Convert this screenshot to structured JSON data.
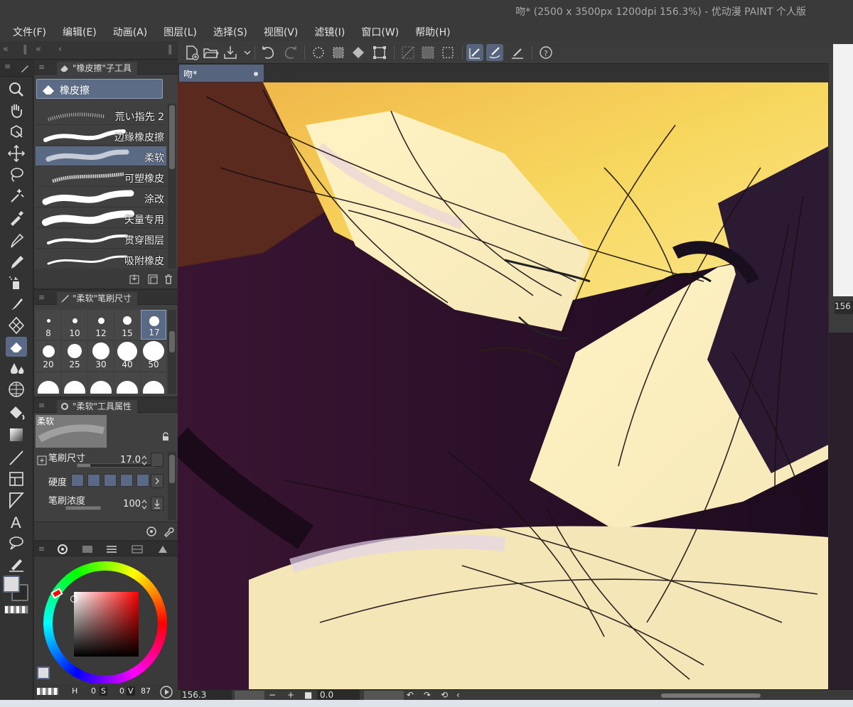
{
  "window": {
    "title": "吻* (2500 x 3500px 1200dpi 156.3%)  - 优动漫 PAINT 个人版"
  },
  "menu": [
    "文件(F)",
    "编辑(E)",
    "动画(A)",
    "图层(L)",
    "选择(S)",
    "视图(V)",
    "滤镜(I)",
    "窗口(W)",
    "帮助(H)"
  ],
  "subtool_panel": {
    "title": "\"橡皮擦\"子工具",
    "group": "橡皮擦",
    "brushes": [
      {
        "name": "荒い指先 2",
        "selected": false
      },
      {
        "name": "边缘橡皮擦",
        "selected": false
      },
      {
        "name": "柔软",
        "selected": true
      },
      {
        "name": "可塑橡皮",
        "selected": false
      },
      {
        "name": "涂改",
        "selected": false
      },
      {
        "name": "矢量专用",
        "selected": false
      },
      {
        "name": "贯穿图层",
        "selected": false
      },
      {
        "name": "吸附橡皮",
        "selected": false
      }
    ]
  },
  "brush_size_panel": {
    "title": "\"柔软\"笔刷尺寸",
    "sizes": [
      "8",
      "10",
      "12",
      "15",
      "17",
      "20",
      "25",
      "30",
      "40",
      "50"
    ],
    "selected": "17"
  },
  "tool_property_panel": {
    "title": "\"柔软\"工具属性",
    "preview_label": "柔软",
    "brush_size_label": "笔刷尺寸",
    "brush_size_value": "17.0",
    "hardness_label": "硬度",
    "hardness_level": 4,
    "density_label": "笔刷浓度",
    "density_value": "100"
  },
  "color_panel": {
    "h_label": "H",
    "h_value": "0",
    "s_label": "S",
    "s_value": "0",
    "v_label": "V",
    "v_value": "87",
    "main_color": "#dedede",
    "sub_color": "#2a2a2a"
  },
  "document": {
    "tab_title": "吻*"
  },
  "navigator": {
    "zoom_text": "156"
  },
  "status": {
    "zoom": "156.3",
    "rotation": "0.0"
  }
}
